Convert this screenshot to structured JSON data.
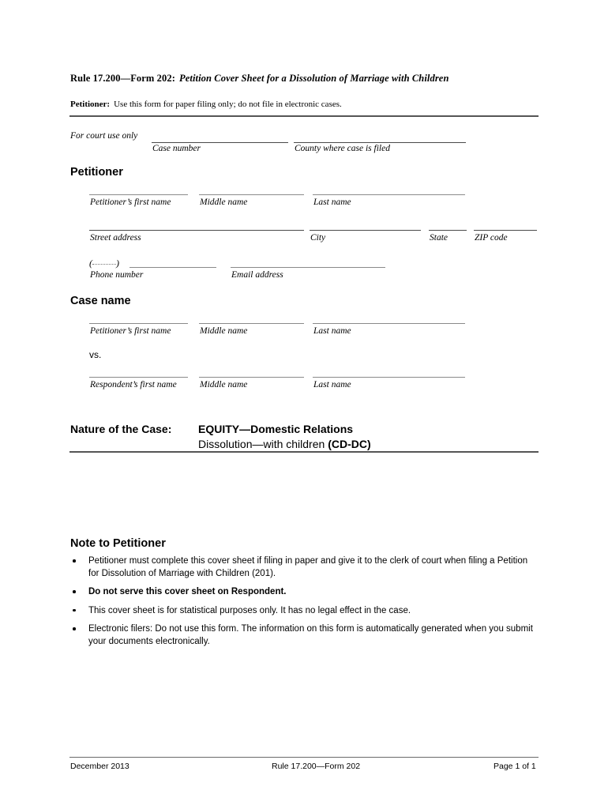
{
  "document": {
    "title_rule": "Rule 17.200—Form 202:",
    "title_subject": "Petition Cover Sheet for a Dissolution of Marriage with Children",
    "petitioner_note_label": "Petitioner:",
    "petitioner_note_text": "Use this form for paper filing only; do not file in electronic cases."
  },
  "court_use": {
    "label": "For court use only",
    "case_number_caption": "Case number",
    "county_caption": "County where case is filed"
  },
  "petitioner_section": {
    "heading": "Petitioner",
    "name_row": {
      "first_caption": "Petitioner’s first name",
      "middle_caption": "Middle name",
      "last_caption": "Last name"
    },
    "address_row": {
      "street_caption": "Street address",
      "city_caption": "City",
      "state_caption": "State",
      "zip_caption": "ZIP code"
    },
    "contact_row": {
      "phone_prefix_open": "(",
      "phone_prefix_close": ")",
      "phone_caption": "Phone number",
      "email_caption": "Email address"
    }
  },
  "case_name_section": {
    "heading": "Case name",
    "petitioner_row": {
      "first_caption": "Petitioner’s first name",
      "middle_caption": "Middle name",
      "last_caption": "Last name"
    },
    "vs_label": "vs.",
    "respondent_row": {
      "first_caption": "Respondent’s first name",
      "middle_caption": "Middle name",
      "last_caption": "Last name"
    }
  },
  "nature_of_case": {
    "label": "Nature of the Case:",
    "line1": "EQUITY—Domestic Relations",
    "line2_text": "Dissolution—with children ",
    "line2_code": "(CD-DC)"
  },
  "note_section": {
    "heading": "Note to Petitioner",
    "bullets": [
      "Petitioner must complete this cover sheet if filing in paper and give it to the clerk of court when filing a Petition for Dissolution of Marriage with Children (201).",
      "Do not serve this cover sheet on Respondent.",
      "This cover sheet is for statistical purposes only.  It has no legal effect in the case.",
      "Electronic filers: Do not use this form.  The information on this form is automatically generated when you submit your documents electronically."
    ]
  },
  "footer": {
    "left": "December 2013",
    "center": "Rule 17.200—Form 202",
    "right": "Page 1 of 1"
  },
  "colors": {
    "text": "#000000",
    "rule_heavy": "#555555",
    "field_line": "#8a8a8a",
    "background": "#ffffff"
  }
}
